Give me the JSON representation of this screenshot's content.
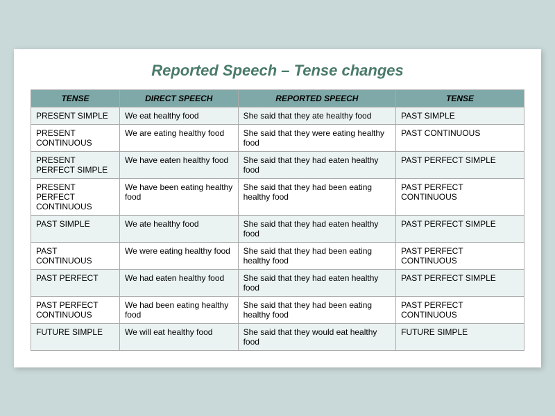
{
  "title": "Reported Speech – Tense changes",
  "header": {
    "col1": "TENSE",
    "col2": "DIRECT SPEECH",
    "col3": "REPORTED SPEECH",
    "col4": "TENSE"
  },
  "rows": [
    {
      "tense": "PRESENT SIMPLE",
      "direct": "We eat healthy food",
      "reported": "She said that they ate healthy food",
      "tense2": "PAST SIMPLE"
    },
    {
      "tense": "PRESENT CONTINUOUS",
      "direct": "We are eating healthy food",
      "reported": "She said that they were eating healthy food",
      "tense2": "PAST CONTINUOUS"
    },
    {
      "tense": "PRESENT PERFECT SIMPLE",
      "direct": "We have eaten healthy food",
      "reported": "She said that they had eaten healthy food",
      "tense2": "PAST PERFECT SIMPLE"
    },
    {
      "tense": "PRESENT PERFECT CONTINUOUS",
      "direct": "We have been eating healthy food",
      "reported": "She said that they had been eating  healthy food",
      "tense2": "PAST PERFECT CONTINUOUS"
    },
    {
      "tense": "PAST SIMPLE",
      "direct": "We ate healthy food",
      "reported": "She said that they had eaten healthy food",
      "tense2": "PAST PERFECT SIMPLE"
    },
    {
      "tense": "PAST CONTINUOUS",
      "direct": "We were eating healthy food",
      "reported": "She said that they had been eating healthy food",
      "tense2": "PAST PERFECT CONTINUOUS"
    },
    {
      "tense": "PAST PERFECT",
      "direct": "We had eaten healthy food",
      "reported": "She said that they had eaten healthy food",
      "tense2": "PAST PERFECT SIMPLE"
    },
    {
      "tense": "PAST PERFECT CONTINUOUS",
      "direct": "We had been eating healthy food",
      "reported": "She said that they had been eating  healthy food",
      "tense2": "PAST PERFECT CONTINUOUS"
    },
    {
      "tense": "FUTURE SIMPLE",
      "direct": "We will eat healthy food",
      "reported": "She said that they would eat healthy food",
      "tense2": "FUTURE SIMPLE"
    }
  ]
}
